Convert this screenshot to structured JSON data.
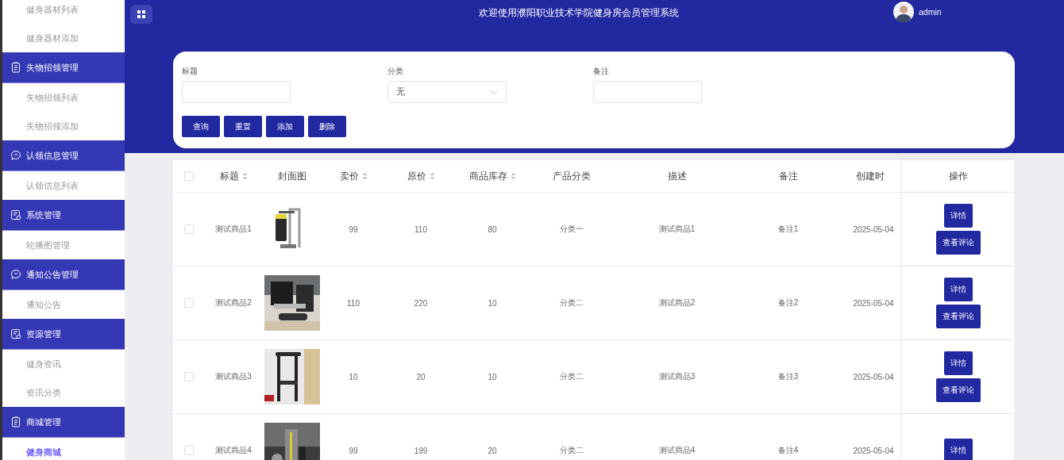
{
  "sidebar": {
    "items": [
      {
        "kind": "item",
        "label": "健身器材列表",
        "selected": false
      },
      {
        "kind": "item",
        "label": "健身器材添加",
        "selected": false
      },
      {
        "kind": "clipboard-group",
        "label": "失物招领管理"
      },
      {
        "kind": "item",
        "label": "失物招领列表",
        "selected": false
      },
      {
        "kind": "item",
        "label": "失物招领添加",
        "selected": false
      },
      {
        "kind": "chat-group",
        "label": "认领信息管理"
      },
      {
        "kind": "item",
        "label": "认领信息列表",
        "selected": false
      },
      {
        "kind": "form-group",
        "label": "系统管理"
      },
      {
        "kind": "item",
        "label": "轮播图管理",
        "selected": false
      },
      {
        "kind": "chat-group",
        "label": "通知公告管理"
      },
      {
        "kind": "item",
        "label": "通知公告",
        "selected": false
      },
      {
        "kind": "form-group",
        "label": "资源管理"
      },
      {
        "kind": "item",
        "label": "健身资讯",
        "selected": false
      },
      {
        "kind": "item",
        "label": "资讯分类",
        "selected": false
      },
      {
        "kind": "clipboard-group",
        "label": "商城管理"
      },
      {
        "kind": "item",
        "label": "健身商城",
        "selected": true
      }
    ]
  },
  "header": {
    "title": "欢迎使用濮阳职业技术学院健身房会员管理系统",
    "user": "admin"
  },
  "filters": [
    {
      "kind": "input",
      "label": "标题"
    },
    {
      "kind": "select",
      "label": "分类",
      "value": "无"
    },
    {
      "kind": "input",
      "label": "备注"
    }
  ],
  "filter_buttons": [
    "查询",
    "重置",
    "添加",
    "删除"
  ],
  "table": {
    "all_selected": false,
    "columns": [
      {
        "label": "标题",
        "sortable": true
      },
      {
        "label": "封面图",
        "sortable": false
      },
      {
        "label": "卖价",
        "sortable": true
      },
      {
        "label": "原价",
        "sortable": true
      },
      {
        "label": "商品库存",
        "sortable": true
      },
      {
        "label": "产品分类",
        "sortable": false
      },
      {
        "label": "描述",
        "sortable": false
      },
      {
        "label": "备注",
        "sortable": false
      },
      {
        "label": "创建时",
        "sortable": false
      },
      {
        "label": "操作",
        "sortable": false
      }
    ],
    "rows": [
      {
        "selected": false,
        "title": "测试商品1",
        "cover": {
          "kind": "picture"
        },
        "price": "99",
        "original_price": "110",
        "stock": "80",
        "category": "分类一",
        "description": "测试商品1",
        "note": "备注1",
        "created": "2025-05-04",
        "actions": [
          "详情",
          "查看评论"
        ]
      },
      {
        "selected": false,
        "title": "测试商品2",
        "cover": {
          "kind": "picture"
        },
        "price": "110",
        "original_price": "220",
        "stock": "10",
        "category": "分类二",
        "description": "测试商品2",
        "note": "备注2",
        "created": "2025-05-04",
        "actions": [
          "详情",
          "查看评论"
        ]
      },
      {
        "selected": false,
        "title": "测试商品3",
        "cover": {
          "kind": "picture"
        },
        "price": "10",
        "original_price": "20",
        "stock": "10",
        "category": "分类二",
        "description": "测试商品3",
        "note": "备注3",
        "created": "2025-05-04",
        "actions": [
          "详情",
          "查看评论"
        ]
      },
      {
        "selected": false,
        "title": "测试商品4",
        "cover": {
          "kind": "picture"
        },
        "price": "99",
        "original_price": "199",
        "stock": "20",
        "category": "分类二",
        "description": "测试商品4",
        "note": "备注4",
        "created": "2025-05-04",
        "actions": [
          "详情"
        ]
      }
    ]
  }
}
